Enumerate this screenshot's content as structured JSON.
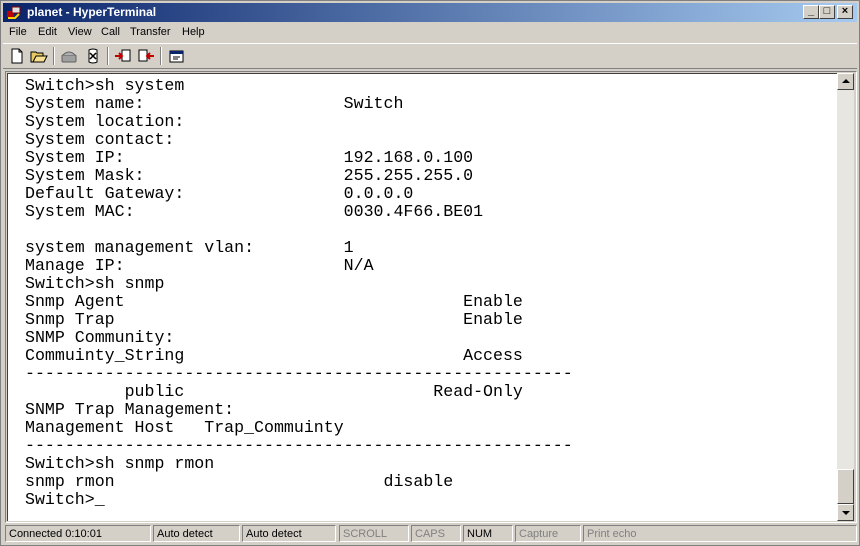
{
  "window": {
    "title": "planet - HyperTerminal",
    "controls": {
      "minimize": "_",
      "maximize": "□",
      "close": "×"
    }
  },
  "menu": [
    {
      "label": "File"
    },
    {
      "label": "Edit"
    },
    {
      "label": "View"
    },
    {
      "label": "Call"
    },
    {
      "label": "Transfer"
    },
    {
      "label": "Help"
    }
  ],
  "toolbar": {
    "icons": [
      "new-connection-icon",
      "open-icon",
      "call-icon",
      "disconnect-icon",
      "send-file-icon",
      "receive-file-icon",
      "properties-icon"
    ]
  },
  "terminal": {
    "lines": [
      "Switch>sh system",
      "System name:                    Switch",
      "System location:",
      "System contact:",
      "System IP:                      192.168.0.100",
      "System Mask:                    255.255.255.0",
      "Default Gateway:                0.0.0.0",
      "System MAC:                     0030.4F66.BE01",
      "",
      "system management vlan:         1",
      "Manage IP:                      N/A",
      "Switch>sh snmp",
      "Snmp Agent                                  Enable",
      "Snmp Trap                                   Enable",
      "SNMP Community:",
      "Commuinty_String                            Access",
      "-------------------------------------------------------",
      "          public                         Read-Only",
      "SNMP Trap Management:",
      "Management Host   Trap_Commuinty",
      "-------------------------------------------------------",
      "Switch>sh snmp rmon",
      "snmp rmon                           disable",
      "Switch>_"
    ]
  },
  "statusbar": [
    {
      "text": "Connected 0:10:01",
      "active": true
    },
    {
      "text": "Auto detect",
      "active": true
    },
    {
      "text": "Auto detect",
      "active": true
    },
    {
      "text": "SCROLL",
      "active": false
    },
    {
      "text": "CAPS",
      "active": false
    },
    {
      "text": "NUM",
      "active": true
    },
    {
      "text": "Capture",
      "active": false
    },
    {
      "text": "Print echo",
      "active": false
    }
  ]
}
